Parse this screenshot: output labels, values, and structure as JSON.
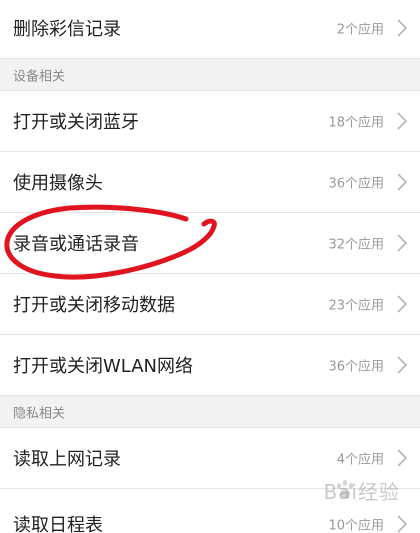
{
  "list": {
    "row_delete_mms": {
      "label": "删除彩信记录",
      "count": "2个应用"
    },
    "section_device": {
      "title": "设备相关"
    },
    "row_bluetooth": {
      "label": "打开或关闭蓝牙",
      "count": "18个应用"
    },
    "row_camera": {
      "label": "使用摄像头",
      "count": "36个应用"
    },
    "row_record": {
      "label": "录音或通话录音",
      "count": "32个应用"
    },
    "row_mobile_data": {
      "label": "打开或关闭移动数据",
      "count": "23个应用"
    },
    "row_wlan": {
      "label": "打开或关闭WLAN网络",
      "count": "36个应用"
    },
    "section_privacy": {
      "title": "隐私相关"
    },
    "row_browser_history": {
      "label": "读取上网记录",
      "count": "4个应用"
    },
    "row_calendar": {
      "label": "读取日程表",
      "count": "10个应用"
    }
  },
  "icons": {
    "chevron": "chevron-right-icon",
    "annotation": "red-hand-drawn-loop",
    "watermark": "paw-logo"
  },
  "colors": {
    "annotation_red": "#e0141e",
    "section_bg": "#f2f2f2",
    "muted_text": "#999999"
  },
  "watermark": {
    "text": "Bai经验"
  }
}
